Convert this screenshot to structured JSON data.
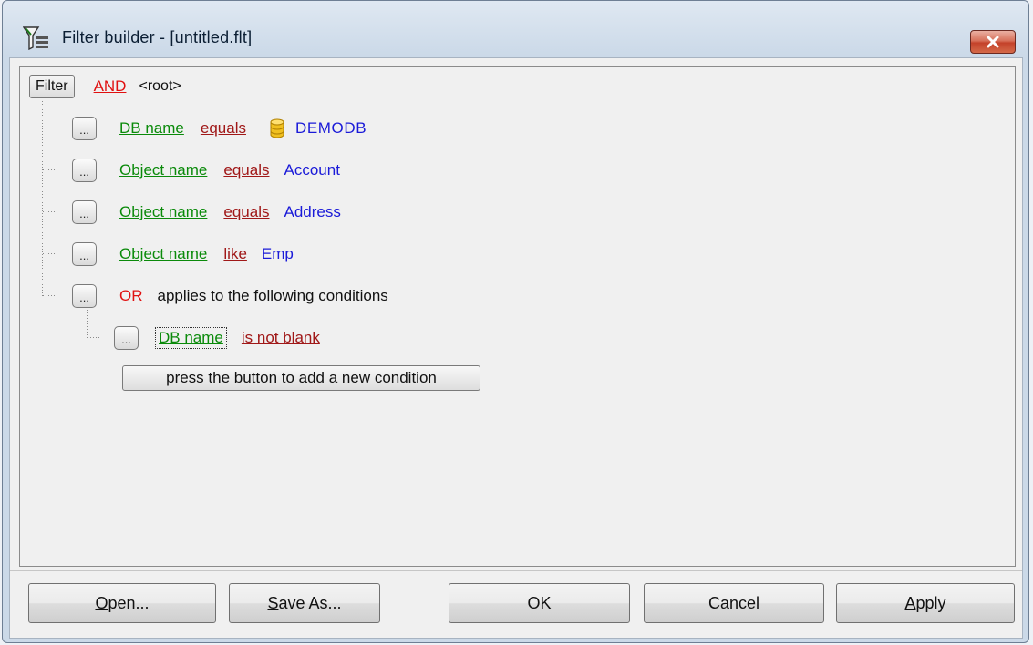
{
  "window": {
    "title": "Filter builder - [untitled.flt]"
  },
  "root": {
    "filter_button": "Filter",
    "operator": "AND",
    "label": "<root>"
  },
  "conditions": [
    {
      "dots": "...",
      "field": "DB name",
      "op": "equals",
      "value": "DEMODB",
      "icon": "database-icon"
    },
    {
      "dots": "...",
      "field": "Object name",
      "op": "equals",
      "value": "Account"
    },
    {
      "dots": "...",
      "field": "Object name",
      "op": "equals",
      "value": "Address"
    },
    {
      "dots": "...",
      "field": "Object name",
      "op": "like",
      "value": "Emp"
    }
  ],
  "group": {
    "dots": "...",
    "operator": "OR",
    "text": "applies to the following conditions",
    "children": [
      {
        "dots": "...",
        "field": "DB name",
        "op": "is not blank"
      }
    ],
    "add_condition": "press the button to add a new condition"
  },
  "buttons": {
    "open": {
      "acc": "O",
      "rest": "pen..."
    },
    "save_as": {
      "acc": "S",
      "rest": "ave As..."
    },
    "ok": "OK",
    "cancel": "Cancel",
    "apply": {
      "acc": "A",
      "rest": "pply"
    }
  },
  "colors": {
    "field": "#0a8a0a",
    "operator": "#a01818",
    "value": "#1a1ad8",
    "group_operator": "#e01010"
  }
}
